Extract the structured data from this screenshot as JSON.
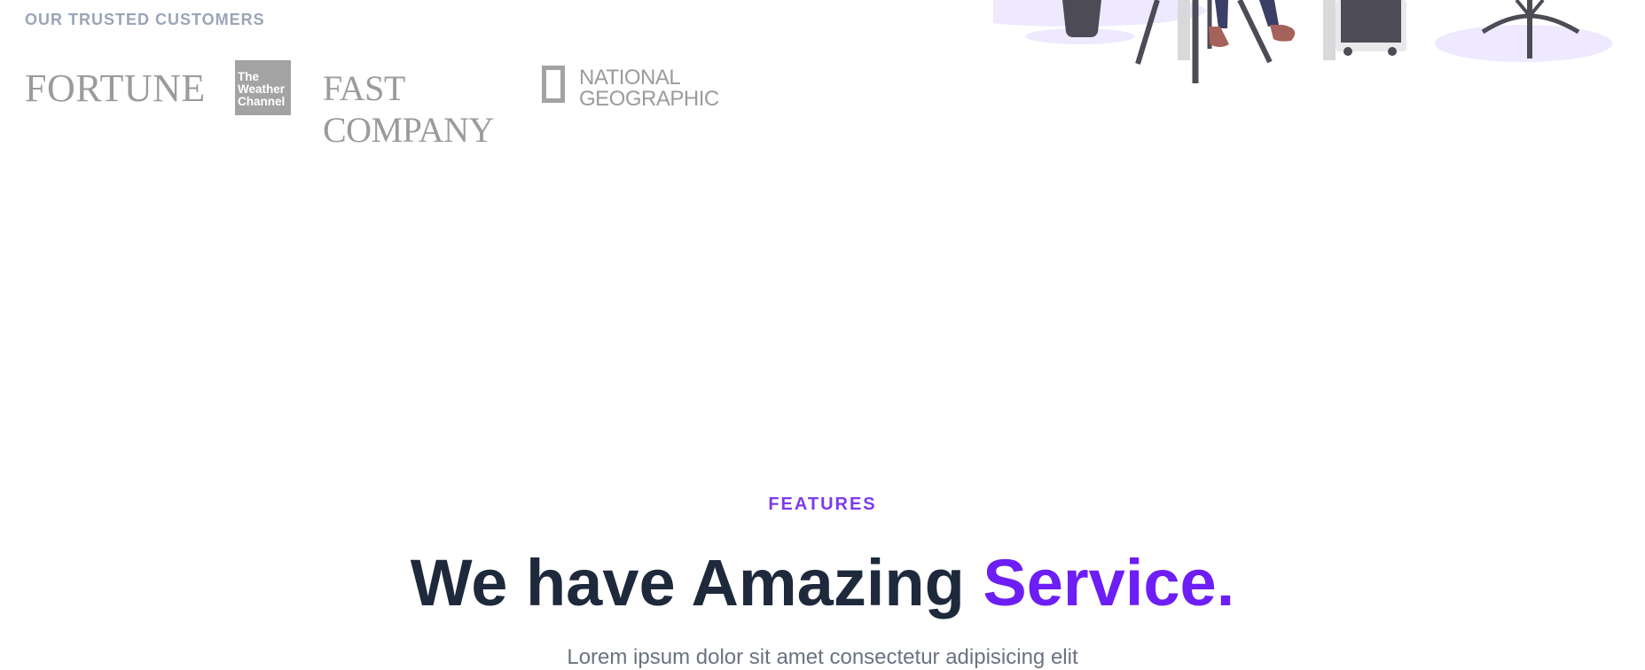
{
  "customers": {
    "heading": "OUR TRUSTED CUSTOMERS",
    "logos": {
      "fortune": "FORTUNE",
      "weather_channel": [
        "The",
        "Weather",
        "Channel"
      ],
      "fast_company": "FAST COMPANY",
      "national_geographic": [
        "NATIONAL",
        "GEOGRAPHIC"
      ]
    }
  },
  "features": {
    "label": "FEATURES",
    "title_main": "We have Amazing ",
    "title_accent": "Service.",
    "description": "Lorem ipsum dolor sit amet consectetur adipisicing elit"
  },
  "colors": {
    "accent": "#6d1ef5",
    "label": "#7c3aed",
    "heading": "#1e293b",
    "muted": "#9aa5b8",
    "illustration_tint": "#efe9ff"
  }
}
